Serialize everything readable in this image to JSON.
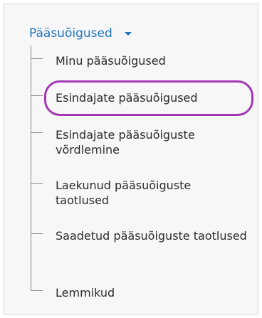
{
  "menu": {
    "header_label": "Pääsuõigused",
    "header_icon": "chevron-down-icon",
    "items": [
      {
        "label": "Minu pääsuõigused"
      },
      {
        "label": "Esindajate pääsuõigused",
        "highlighted": true
      },
      {
        "label": "Esindajate pääsuõiguste võrdlemine"
      },
      {
        "label": "Laekunud pääsuõiguste taotlused"
      },
      {
        "label": "Saadetud pääsuõiguste taotlused"
      },
      {
        "label": "Lemmikud"
      }
    ]
  },
  "colors": {
    "link": "#1e73be",
    "text": "#2b2b2b",
    "highlight": "#a238b4",
    "tree_line": "#8a8a8a",
    "panel_bg": "#f7f7f7"
  }
}
